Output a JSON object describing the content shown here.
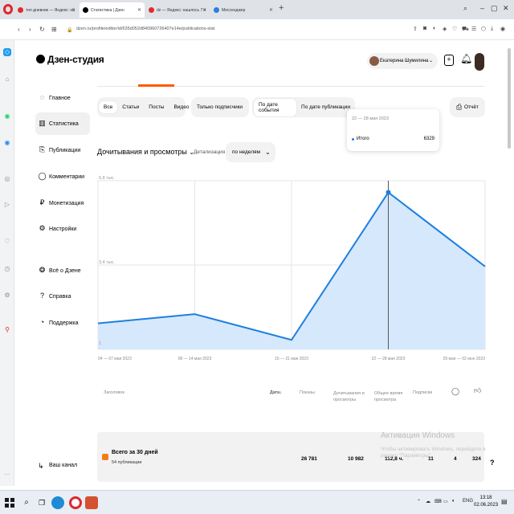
{
  "browser": {
    "tabs": [
      {
        "label": "топ дневник — Яндекс: на",
        "favicon": "#e02b2b"
      },
      {
        "label": "Статистика | Дзен",
        "favicon": "#000000",
        "active": true
      },
      {
        "label": "dz — Яндекс: нашлось 7 н",
        "favicon": "#e02b2b"
      },
      {
        "label": "Мессенджер",
        "favicon": "#2a7de1"
      }
    ],
    "new_tab": "+",
    "url": "dzen.ru/profile/editor/id/635d052d840960726407e14e/publications-stat"
  },
  "app": {
    "logo": "Дзен-студия",
    "user_name": "Екатерина Шумилина"
  },
  "nav": [
    {
      "label": "Главное",
      "icon": "lightbulb-icon",
      "glyph": "💡"
    },
    {
      "label": "Статистика",
      "icon": "bar-chart-icon",
      "glyph": "▥",
      "active": true
    },
    {
      "label": "Публикации",
      "icon": "document-icon",
      "glyph": "⎘"
    },
    {
      "label": "Комментарии",
      "icon": "comment-icon",
      "glyph": "◯"
    },
    {
      "label": "Монетизация",
      "icon": "ruble-icon",
      "glyph": "₽"
    },
    {
      "label": "Настройки",
      "icon": "gear-icon",
      "glyph": "⚙"
    },
    {
      "label": "Всё о Дзене",
      "icon": "info-icon",
      "glyph": "❂"
    },
    {
      "label": "Справка",
      "icon": "help-icon",
      "glyph": "?"
    },
    {
      "label": "Поддержка",
      "icon": "support-icon",
      "glyph": "◔"
    }
  ],
  "channel_link": "Ваш канал",
  "filters": {
    "content": [
      "Все",
      "Статьи",
      "Посты",
      "Видео"
    ],
    "subscribers": "Только подписчики",
    "date_mode": [
      "По дате события",
      "По дате публикации"
    ]
  },
  "report_button": "Отчёт",
  "popup": {
    "date": "22 — 28 мая 2023",
    "label": "Итого",
    "value": "6329"
  },
  "chart_header": {
    "title": "Дочитывания и просмотры",
    "detail_label": "Детализация",
    "period": "по неделям"
  },
  "chart_data": {
    "type": "area",
    "categories": [
      "04 — 07 мая 2023",
      "08 — 14 мая 2023",
      "15 — 21 мая 2023",
      "22 — 28 мая 2023",
      "29 мая — 02 июн 2023"
    ],
    "values": [
      1050,
      1420,
      380,
      6329,
      3340
    ],
    "y_ticks": [
      "6,8 тыс.",
      "3,4 тыс.",
      "1"
    ],
    "ylim": [
      0,
      6800
    ],
    "highlight_index": 3,
    "colors": {
      "line": "#1d7fe0",
      "fill": "#d6e8fb",
      "grid": "#e5e5e5"
    }
  },
  "table": {
    "headers": {
      "title": "Заголовок",
      "date": "Дата",
      "views": "Показы",
      "reads": "Дочитывания и просмотры",
      "time": "Общее время просмотра",
      "subscriptions": "Подписки"
    },
    "totals": {
      "title": "Всего за 30 дней",
      "sub": "54 публикации",
      "views": "26 781",
      "reads": "10 982",
      "time": "112,8 ч.",
      "subscriptions": "11",
      "comments": "4",
      "likes": "324"
    }
  },
  "watermark": {
    "title": "Активация Windows",
    "text": "Чтобы активировать Windows, перейдите в раздел \"Параметры\"."
  },
  "taskbar": {
    "lang": "ENG",
    "time": "13:18",
    "date": "02.06.2023"
  }
}
